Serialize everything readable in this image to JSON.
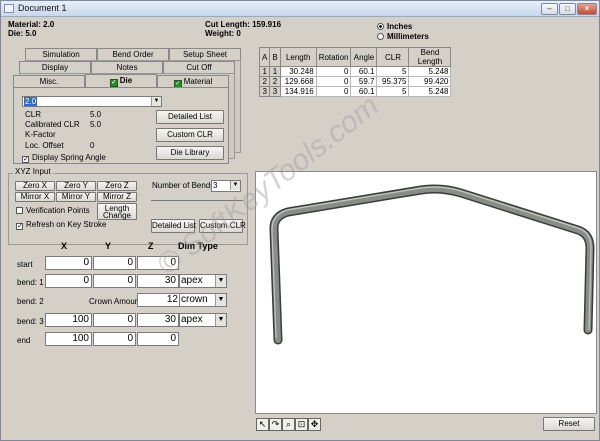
{
  "window": {
    "title": "Document 1",
    "min": "–",
    "max": "□",
    "close": "×"
  },
  "info": {
    "material": "Material: 2.0",
    "die": "Die: 5.0",
    "cut_length": "Cut Length: 159.916",
    "weight": "Weight: 0"
  },
  "units": {
    "inches": "Inches",
    "millimeters": "Millimeters",
    "selected": "Inches"
  },
  "tabs": {
    "row1": [
      "Simulation",
      "Bend Order",
      "Setup Sheet"
    ],
    "row2": [
      "Display",
      "Notes",
      "Cut Off"
    ],
    "row3": [
      "Misc.",
      "Die",
      "Material"
    ]
  },
  "die_panel": {
    "die_select": "2.0",
    "clr_label": "CLR",
    "clr_value": "5.0",
    "cal_clr_label": "Calibrated CLR",
    "cal_clr_value": "5.0",
    "kfactor_label": "K-Factor",
    "loc_offset_label": "Loc. Offset",
    "loc_offset_value": "0",
    "spring_angle_label": "Display Spring Angle",
    "detailed_list": "Detailed List",
    "custom_clr": "Custom CLR",
    "die_library": "Die Library"
  },
  "grid": {
    "headers": [
      "A",
      "B",
      "Length",
      "Rotation",
      "Angle",
      "CLR",
      "Bend Length"
    ],
    "rows": [
      [
        "1",
        "1",
        "30.248",
        "0",
        "60.1",
        "5",
        "5.248"
      ],
      [
        "2",
        "2",
        "129.668",
        "0",
        "59.7",
        "95.375",
        "99.420"
      ],
      [
        "3",
        "3",
        "134.916",
        "0",
        "60.1",
        "5",
        "5.248"
      ]
    ]
  },
  "xyz": {
    "group_label": "XYZ Input",
    "zero_x": "Zero X",
    "zero_y": "Zero Y",
    "zero_z": "Zero Z",
    "mirror_x": "Mirror X",
    "mirror_y": "Mirror Y",
    "mirror_z": "Mirror Z",
    "verification_points": "Verification Points",
    "length_change": "Length Change",
    "refresh": "Refresh on Key Stroke",
    "num_bends_label": "Number of Bends:",
    "num_bends": "3",
    "detailed_list": "Detailed List",
    "custom_clr": "Custom CLR",
    "col_x": "X",
    "col_y": "Y",
    "col_z": "Z",
    "col_dim": "Dim Type",
    "crown_amount_label": "Crown Amount:",
    "rows": [
      {
        "label": "start",
        "x": "0",
        "y": "0",
        "z": "0",
        "dim": ""
      },
      {
        "label": "bend: 1",
        "x": "0",
        "y": "0",
        "z": "30",
        "dim": "apex"
      },
      {
        "label": "bend: 2",
        "x": "",
        "y": "",
        "z": "12",
        "dim": "crown"
      },
      {
        "label": "bend: 3",
        "x": "100",
        "y": "0",
        "z": "30",
        "dim": "apex"
      },
      {
        "label": "end",
        "x": "100",
        "y": "0",
        "z": "0",
        "dim": ""
      }
    ]
  },
  "view": {
    "reset": "Reset",
    "watermark": "© SoftKeyTools.com"
  },
  "colors": {
    "tube": "#8a8c88",
    "tube_edge": "#3a3c3a",
    "selection": "#316ac5"
  }
}
